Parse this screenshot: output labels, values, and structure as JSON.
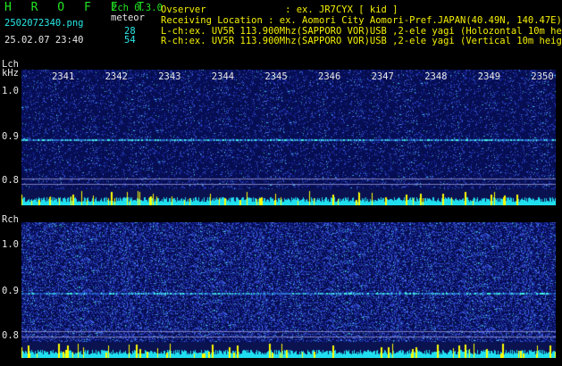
{
  "app": {
    "logo": "H R O F F T",
    "mode": "2ch 0.3.0",
    "meteor_label": "meteor",
    "filename": "2502072340.png",
    "datetime": "25.02.07 23:40",
    "count_lch": "28",
    "count_rch": "54"
  },
  "info": {
    "observer": "Ovserver              : ex. JR7CYX [ kid ]",
    "location": "Receiving Location : ex. Aomori City Aomori-Pref.JAPAN(40.49N, 140.47E)",
    "lch": "L-ch:ex. UV5R 113.900Mhz(SAPPORO VOR)USB ,2-ele yagi (Holozontal 10m height",
    "rch": "R-ch:ex. UV5R 113.900Mhz(SAPPORO VOR)USB ,2-ele yagi (Vertical 10m height)"
  },
  "lch": {
    "label": "Lch",
    "unit": "kHz",
    "ticks_y": [
      "1.0",
      "0.9",
      "0.8"
    ]
  },
  "rch": {
    "label": "Rch",
    "ticks_y": [
      "1.0",
      "0.9",
      "0.8"
    ]
  },
  "time_ticks": [
    "2341",
    "2342",
    "2343",
    "2344",
    "2345",
    "2346",
    "2347",
    "2348",
    "2349",
    "2350"
  ],
  "colors": {
    "background": "#000000",
    "green_text": "#22e622",
    "cyan_text": "#2ae8e8",
    "yellow_text": "#f4f000",
    "spectrum_base": "#1a2a90",
    "level_cyan": "#20e0f0",
    "level_yellow": "#ffff00"
  }
}
